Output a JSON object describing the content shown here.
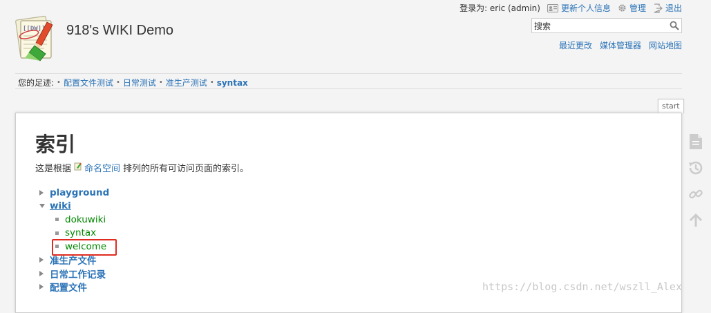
{
  "header": {
    "site_title": "918's WIKI Demo",
    "login_label": "登录为: eric (admin)",
    "user_tools": [
      {
        "label": "更新个人信息",
        "icon": "profile-card-icon"
      },
      {
        "label": "管理",
        "icon": "gear-icon"
      },
      {
        "label": "退出",
        "icon": "logout-icon"
      }
    ],
    "search": {
      "value": "搜索",
      "icon": "search-icon"
    },
    "site_tools": [
      "最近更改",
      "媒体管理器",
      "网站地图"
    ]
  },
  "breadcrumbs": {
    "label": "您的足迹:",
    "items": [
      "配置文件测试",
      "日常测试",
      "准生产测试"
    ],
    "current": "syntax"
  },
  "page_id": "start",
  "content": {
    "heading": "索引",
    "intro_before": "这是根据",
    "intro_link": "命名空间",
    "intro_after": "排列的所有可访问页面的索引。",
    "tree": [
      {
        "type": "ns",
        "label": "playground",
        "open": false
      },
      {
        "type": "ns",
        "label": "wiki",
        "open": true
      },
      {
        "type": "page",
        "label": "dokuwiki"
      },
      {
        "type": "page",
        "label": "syntax"
      },
      {
        "type": "page",
        "label": "welcome"
      },
      {
        "type": "ns",
        "label": "准生产文件",
        "open": false
      },
      {
        "type": "ns",
        "label": "日常工作记录",
        "open": false
      },
      {
        "type": "ns",
        "label": "配置文件",
        "open": false
      }
    ]
  },
  "page_tools": [
    "document-icon",
    "history-icon",
    "backlink-icon",
    "back-to-top-icon"
  ],
  "watermark": "https://blog.csdn.net/wszll_Alex",
  "colors": {
    "link": "#2b73b7",
    "page_link": "#008800",
    "highlight": "#e02b20"
  }
}
